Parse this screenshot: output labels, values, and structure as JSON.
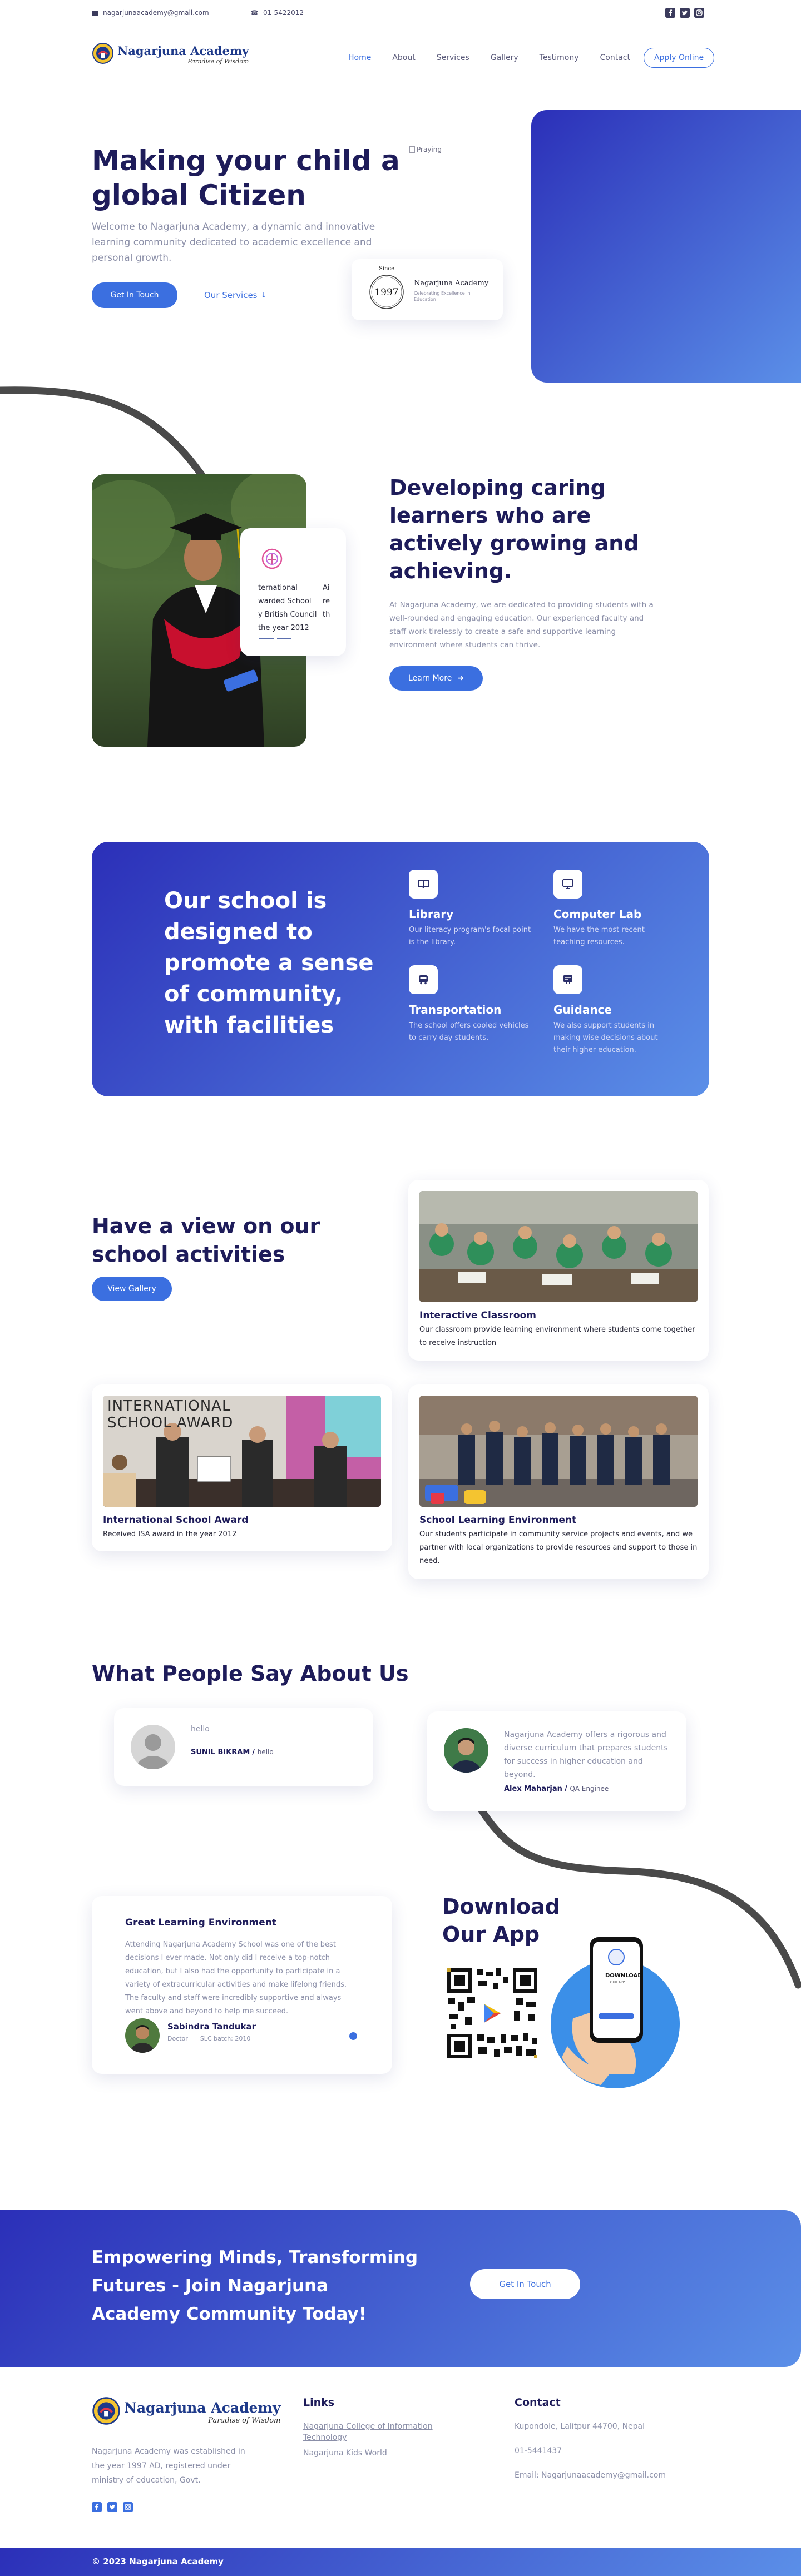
{
  "topbar": {
    "email": "nagarjunaacademy@gmail.com",
    "phone": "01-5422012"
  },
  "brand": {
    "name": "Nagarjuna Academy",
    "tagline": "Paradise of Wisdom"
  },
  "nav": {
    "items": [
      "Home",
      "About",
      "Services",
      "Gallery",
      "Testimony",
      "Contact"
    ],
    "cta": "Apply Online"
  },
  "hero": {
    "title": "Making your child a global Citizen",
    "subtitle": "Welcome to Nagarjuna Academy, a dynamic and innovative learning community dedicated to academic excellence and personal growth.",
    "primary_button": "Get In Touch",
    "secondary_button": "Our Services",
    "image_alt": "Praying",
    "badge": {
      "since_label": "Since",
      "year": "1997",
      "name": "Nagarjuna Academy",
      "tagline": "Celebrating Excellence in Education"
    }
  },
  "about": {
    "title": "Developing caring learners who are actively growing and achieving.",
    "text": "At Nagarjuna Academy, we are dedicated to providing students with a well-rounded and engaging education. Our experienced faculty and staff work tirelessly to create a safe and supportive learning environment where students can thrive.",
    "button": "Learn More",
    "award_card": {
      "col1": [
        "ternational",
        "warded School",
        "y British Council",
        "the year 2012"
      ],
      "col2": [
        "Ai",
        "re",
        "th",
        ""
      ]
    }
  },
  "facilities": {
    "title": "Our school is designed to promote a sense of community, with facilities",
    "items": [
      {
        "icon": "book-icon",
        "title": "Library",
        "text": "Our literacy program's focal point is the library."
      },
      {
        "icon": "monitor-icon",
        "title": "Computer Lab",
        "text": "We have the most recent teaching resources."
      },
      {
        "icon": "bus-icon",
        "title": "Transportation",
        "text": "The school offers cooled vehicles to carry day students."
      },
      {
        "icon": "guidance-icon",
        "title": "Guidance",
        "text": "We also support students in making wise decisions about their higher education."
      }
    ]
  },
  "gallery": {
    "title": "Have a view on our school activities",
    "button": "View Gallery",
    "cards": [
      {
        "title": "Interactive Classroom",
        "text": "Our classroom provide learning environment where students come together to receive instruction"
      },
      {
        "title": "International School Award",
        "text": "Received ISA award in the year 2012",
        "image_text": "INTERNATIONAL SCHOOL AWARD"
      },
      {
        "title": "School Learning Environment",
        "text": "Our students participate in community service projects and events, and we partner with local organizations to provide resources and support to those in need."
      }
    ]
  },
  "testimonials": {
    "title": "What People Say About Us",
    "items": [
      {
        "quote": "hello",
        "name": "SUNIL BIKRAM",
        "role": "hello"
      },
      {
        "quote": "Nagarjuna Academy offers a rigorous and diverse curriculum that prepares students for success in higher education and beyond.",
        "name": "Alex Maharjan",
        "role": "QA Enginee"
      },
      {
        "heading": "Great Learning Environment",
        "quote": "Attending Nagarjuna Academy School was one of the best decisions I ever made. Not only did I receive a top-notch education, but I also had the opportunity to participate in a variety of extracurricular activities and make lifelong friends. The faculty and staff were incredibly supportive and always went above and beyond to help me succeed.",
        "name": "Sabindra Tandukar",
        "role": "Doctor",
        "batch": "SLC batch: 2010"
      }
    ]
  },
  "app": {
    "title": "Download Our App",
    "phone_text": "DOWNLOAD",
    "phone_sub": "OUR APP"
  },
  "cta_banner": {
    "title": "Empowering Minds, Transforming Futures - Join Nagarjuna Academy Community Today!",
    "button": "Get In Touch"
  },
  "footer": {
    "about": "Nagarjuna Academy was established in the year 1997 AD, registered under ministry of education, Govt.",
    "links_title": "Links",
    "links": [
      "Nagarjuna College of Information Technology",
      "Nagarjuna Kids World"
    ],
    "contact_title": "Contact",
    "address": "Kupondole, Lalitpur 44700, Nepal",
    "phone": "01-5441437",
    "email": "Email: Nagarjunaacademy@gmail.com",
    "copyright": "© 2023 Nagarjuna Academy"
  },
  "colors": {
    "primary": "#3b6fe0",
    "navy": "#1e1c5a",
    "gradient_start": "#2b2fb8",
    "gradient_end": "#5b8fe8"
  }
}
